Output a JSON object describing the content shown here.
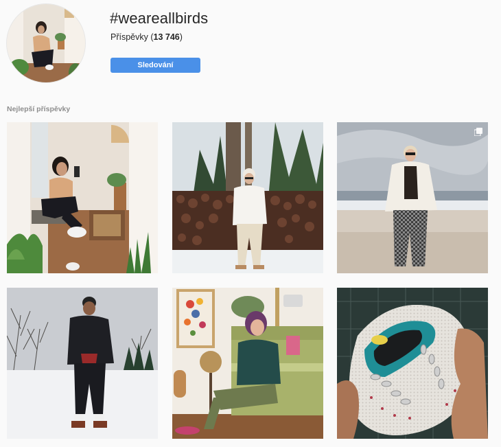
{
  "header": {
    "hashtag": "#weareallbirds",
    "posts_label": "Příspěvky (",
    "posts_count": "13 746",
    "posts_suffix": ")",
    "follow_label": "Sledování"
  },
  "section": {
    "top_posts_label": "Nejlepší příspěvky"
  },
  "icons": {
    "multi_post": "multiple-photos-icon"
  },
  "colors": {
    "follow_button": "#4a90e8",
    "section_label": "#8e8e8e",
    "background": "#fafafa"
  }
}
